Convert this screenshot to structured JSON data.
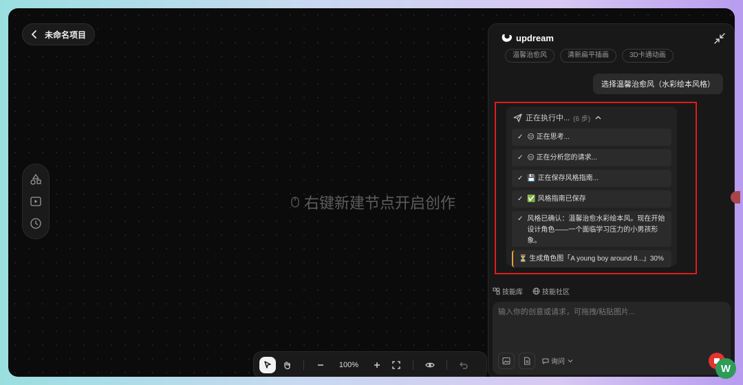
{
  "project": {
    "back_label": "未命名项目"
  },
  "canvas": {
    "hint": "右键新建节点开启创作"
  },
  "toolbar": {
    "zoom": "100%"
  },
  "panel": {
    "brand": "updream",
    "style_chips": [
      "温馨治愈风",
      "清新扁平插画",
      "3D卡通动画"
    ],
    "user_message": "选择温馨治愈风（水彩绘本风格）",
    "execution": {
      "title": "正在执行中...",
      "step_count": "(6 步)",
      "steps": [
        "😑 正在思考...",
        "😑 正在分析您的请求...",
        "💾 正在保存风格指南...",
        "✅ 风格指南已保存",
        "风格已确认：温馨治愈水彩绘本风。现在开始设计角色——一个面临学习压力的小男孩形象。"
      ],
      "progress_step": "⏳ 生成角色图「A young boy around 8...」30%"
    },
    "skills_library": "技能库",
    "skills_community": "技能社区",
    "input_placeholder": "输入你的创意或请求，可拖拽/粘贴图片...",
    "mode": "询问",
    "check_mark": "✓"
  },
  "badge": {
    "letter": "W"
  },
  "colors": {
    "stop": "#e5332f",
    "highlight_border": "#e01c1c",
    "badge": "#2e9b59"
  }
}
